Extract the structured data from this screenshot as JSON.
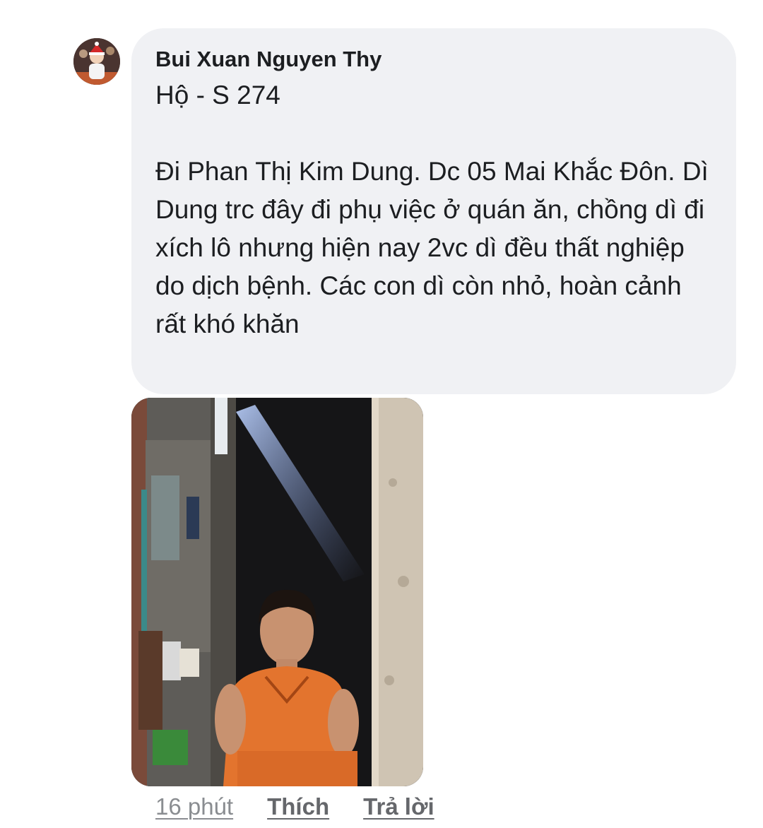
{
  "comment": {
    "author": "Bui Xuan Nguyen Thy",
    "text": "Hộ - S 274\n\nĐi Phan Thị Kim Dung. Dc 05 Mai Khắc Đôn. Dì Dung trc đây đi phụ việc ở quán ăn, chồng dì đi xích lô nhưng hiện nay 2vc dì đều thất nghiệp do dịch bệnh. Các con dì còn nhỏ, hoàn cảnh rất khó khăn",
    "avatar_icon": "profile-photo",
    "attached_photo_icon": "photo-woman-in-orange-in-doorway"
  },
  "actions": {
    "time": "16 phút",
    "like": "Thích",
    "reply": "Trả lời"
  },
  "colors": {
    "bubble_bg": "#f0f1f4",
    "text": "#1c1e21",
    "meta": "#65676b"
  }
}
